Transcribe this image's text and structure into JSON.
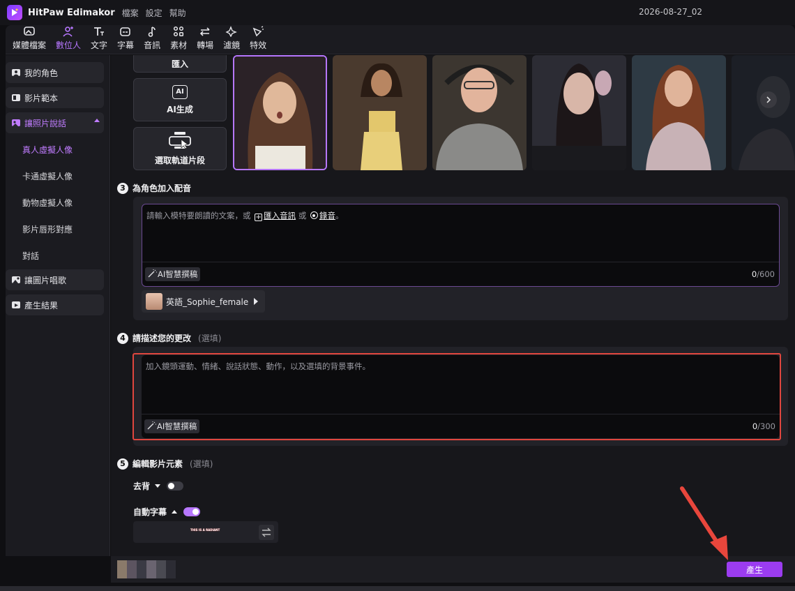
{
  "app": {
    "title": "HitPaw Edimakor",
    "project_name": "2026-08-27_02"
  },
  "menu": [
    "檔案",
    "設定",
    "幫助"
  ],
  "toolbar": [
    {
      "label": "媒體檔案",
      "icon": "media-icon"
    },
    {
      "label": "數位人",
      "icon": "avatar-icon"
    },
    {
      "label": "文字",
      "icon": "text-icon"
    },
    {
      "label": "字幕",
      "icon": "subtitle-icon"
    },
    {
      "label": "音訊",
      "icon": "music-icon"
    },
    {
      "label": "素材",
      "icon": "elements-icon"
    },
    {
      "label": "轉場",
      "icon": "transition-icon"
    },
    {
      "label": "濾鏡",
      "icon": "filter-icon"
    },
    {
      "label": "特效",
      "icon": "effects-icon"
    }
  ],
  "sidebar": {
    "items": [
      {
        "label": "我的角色"
      },
      {
        "label": "影片範本"
      },
      {
        "label": "讓照片說話"
      },
      {
        "label": "讓圖片唱歌"
      },
      {
        "label": "產生結果"
      }
    ],
    "subitems": [
      "真人虛擬人像",
      "卡通虛擬人像",
      "動物虛擬人像",
      "影片唇形對應",
      "對話"
    ]
  },
  "source_buttons": {
    "import": "匯入",
    "ai_generate": "AI生成",
    "ai_icon_text": "AI",
    "select_clip": "選取軌道片段"
  },
  "step3": {
    "number": "3",
    "title": "為角色加入配音",
    "prompt_prefix": "請輸入模特要朗讀的文案，或",
    "import_audio": "匯入音訊",
    "or_text": "或",
    "record": "錄音",
    "period": "。",
    "ai_button": "AI智慧撰稿",
    "count": "0",
    "max": "/600",
    "voice": "英語_Sophie_female"
  },
  "step4": {
    "number": "4",
    "title": "請描述您的更改",
    "optional": "(選填)",
    "placeholder": "加入鏡頭運動、情緒、說話狀態、動作，以及選填的背景事件。",
    "ai_button": "AI智慧撰稿",
    "count": "0",
    "max": "/300"
  },
  "step5": {
    "number": "5",
    "title": "編輯影片元素",
    "optional": "(選填)",
    "remove_bg": {
      "label": "去背",
      "on": false
    },
    "auto_subtitle": {
      "label": "自動字幕",
      "on": true
    },
    "subtitle_preview_text": "THIS IS A RADIANT"
  },
  "generate_label": "產生",
  "colors": {
    "accent": "#b777ff",
    "generate": "#9b3cf0",
    "highlight_border": "#e0463e"
  }
}
